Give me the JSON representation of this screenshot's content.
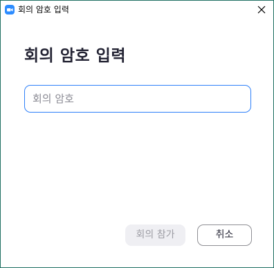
{
  "window": {
    "title": "회의 암호 입력",
    "app_icon": "zoom-camera-icon",
    "close_icon": "close-icon"
  },
  "dialog": {
    "heading": "회의 암호 입력",
    "password_input": {
      "value": "",
      "placeholder": "회의 암호"
    },
    "join_button": {
      "label": "회의 참가",
      "enabled": false
    },
    "cancel_button": {
      "label": "취소"
    }
  },
  "colors": {
    "accent": "#2d8cff",
    "focus_border": "#2d7ff9",
    "window_border": "#1f6f62",
    "heading_text": "#232333"
  }
}
